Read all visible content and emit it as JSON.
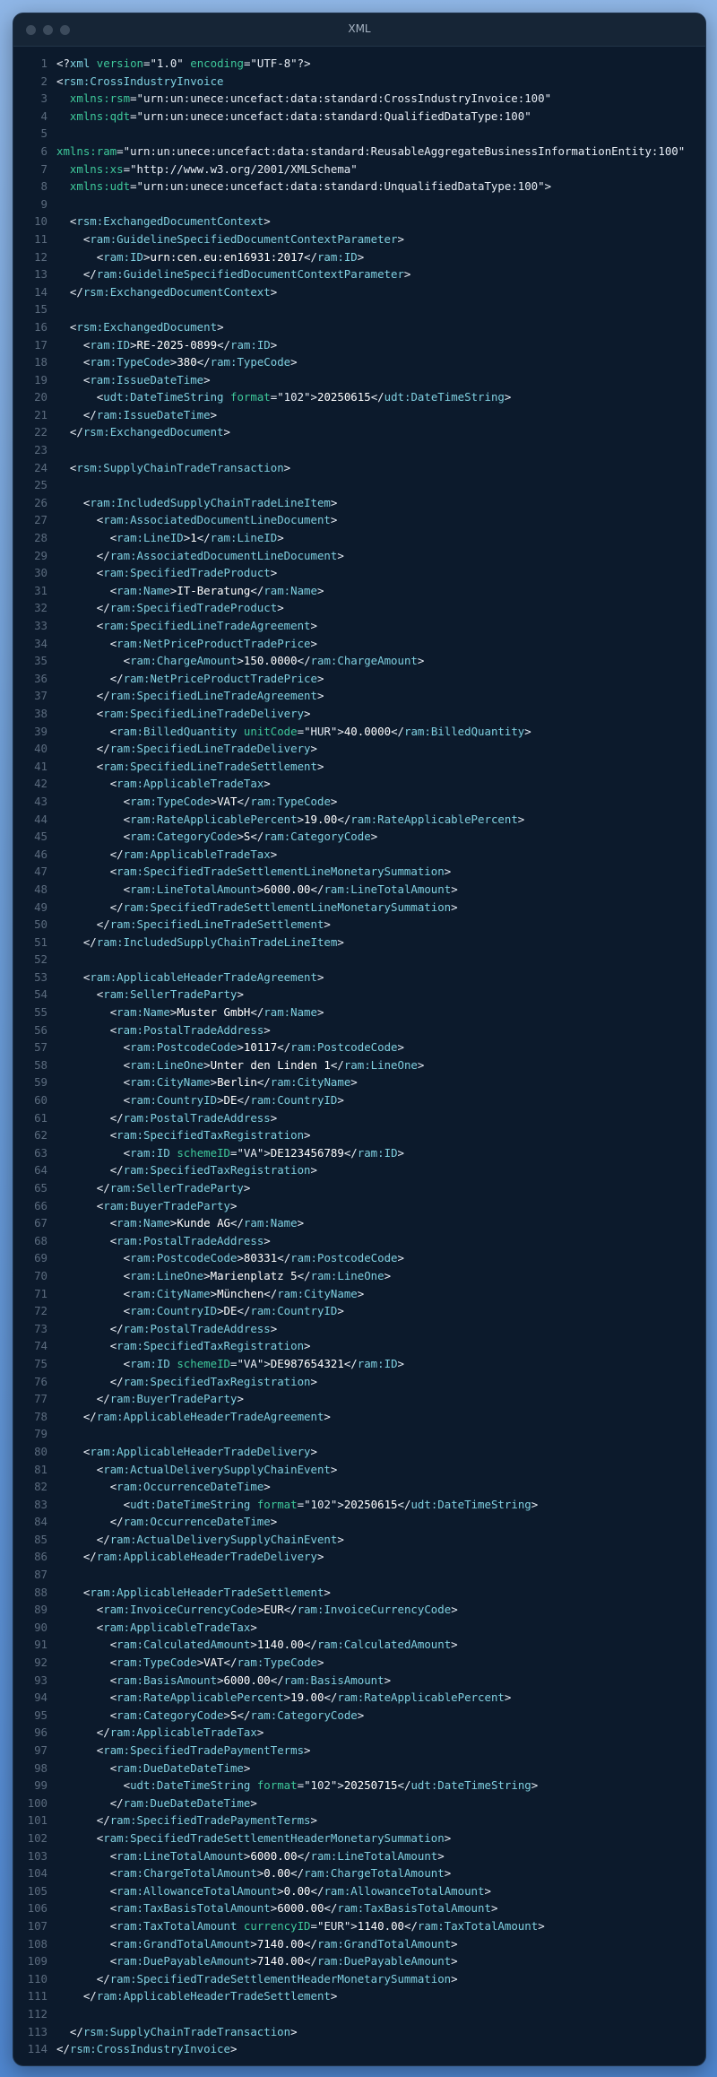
{
  "window": {
    "title": "XML"
  },
  "lines": [
    "<?xml version=\"1.0\" encoding=\"UTF-8\"?>",
    "<rsm:CrossIndustryInvoice",
    "  xmlns:rsm=\"urn:un:unece:uncefact:data:standard:CrossIndustryInvoice:100\"",
    "  xmlns:qdt=\"urn:un:unece:uncefact:data:standard:QualifiedDataType:100\"",
    "",
    "xmlns:ram=\"urn:un:unece:uncefact:data:standard:ReusableAggregateBusinessInformationEntity:100\"",
    "  xmlns:xs=\"http://www.w3.org/2001/XMLSchema\"",
    "  xmlns:udt=\"urn:un:unece:uncefact:data:standard:UnqualifiedDataType:100\">",
    "",
    "  <rsm:ExchangedDocumentContext>",
    "    <ram:GuidelineSpecifiedDocumentContextParameter>",
    "      <ram:ID>urn:cen.eu:en16931:2017</ram:ID>",
    "    </ram:GuidelineSpecifiedDocumentContextParameter>",
    "  </rsm:ExchangedDocumentContext>",
    "",
    "  <rsm:ExchangedDocument>",
    "    <ram:ID>RE-2025-0899</ram:ID>",
    "    <ram:TypeCode>380</ram:TypeCode>",
    "    <ram:IssueDateTime>",
    "      <udt:DateTimeString format=\"102\">20250615</udt:DateTimeString>",
    "    </ram:IssueDateTime>",
    "  </rsm:ExchangedDocument>",
    "",
    "  <rsm:SupplyChainTradeTransaction>",
    "",
    "    <ram:IncludedSupplyChainTradeLineItem>",
    "      <ram:AssociatedDocumentLineDocument>",
    "        <ram:LineID>1</ram:LineID>",
    "      </ram:AssociatedDocumentLineDocument>",
    "      <ram:SpecifiedTradeProduct>",
    "        <ram:Name>IT-Beratung</ram:Name>",
    "      </ram:SpecifiedTradeProduct>",
    "      <ram:SpecifiedLineTradeAgreement>",
    "        <ram:NetPriceProductTradePrice>",
    "          <ram:ChargeAmount>150.0000</ram:ChargeAmount>",
    "        </ram:NetPriceProductTradePrice>",
    "      </ram:SpecifiedLineTradeAgreement>",
    "      <ram:SpecifiedLineTradeDelivery>",
    "        <ram:BilledQuantity unitCode=\"HUR\">40.0000</ram:BilledQuantity>",
    "      </ram:SpecifiedLineTradeDelivery>",
    "      <ram:SpecifiedLineTradeSettlement>",
    "        <ram:ApplicableTradeTax>",
    "          <ram:TypeCode>VAT</ram:TypeCode>",
    "          <ram:RateApplicablePercent>19.00</ram:RateApplicablePercent>",
    "          <ram:CategoryCode>S</ram:CategoryCode>",
    "        </ram:ApplicableTradeTax>",
    "        <ram:SpecifiedTradeSettlementLineMonetarySummation>",
    "          <ram:LineTotalAmount>6000.00</ram:LineTotalAmount>",
    "        </ram:SpecifiedTradeSettlementLineMonetarySummation>",
    "      </ram:SpecifiedLineTradeSettlement>",
    "    </ram:IncludedSupplyChainTradeLineItem>",
    "",
    "    <ram:ApplicableHeaderTradeAgreement>",
    "      <ram:SellerTradeParty>",
    "        <ram:Name>Muster GmbH</ram:Name>",
    "        <ram:PostalTradeAddress>",
    "          <ram:PostcodeCode>10117</ram:PostcodeCode>",
    "          <ram:LineOne>Unter den Linden 1</ram:LineOne>",
    "          <ram:CityName>Berlin</ram:CityName>",
    "          <ram:CountryID>DE</ram:CountryID>",
    "        </ram:PostalTradeAddress>",
    "        <ram:SpecifiedTaxRegistration>",
    "          <ram:ID schemeID=\"VA\">DE123456789</ram:ID>",
    "        </ram:SpecifiedTaxRegistration>",
    "      </ram:SellerTradeParty>",
    "      <ram:BuyerTradeParty>",
    "        <ram:Name>Kunde AG</ram:Name>",
    "        <ram:PostalTradeAddress>",
    "          <ram:PostcodeCode>80331</ram:PostcodeCode>",
    "          <ram:LineOne>Marienplatz 5</ram:LineOne>",
    "          <ram:CityName>München</ram:CityName>",
    "          <ram:CountryID>DE</ram:CountryID>",
    "        </ram:PostalTradeAddress>",
    "        <ram:SpecifiedTaxRegistration>",
    "          <ram:ID schemeID=\"VA\">DE987654321</ram:ID>",
    "        </ram:SpecifiedTaxRegistration>",
    "      </ram:BuyerTradeParty>",
    "    </ram:ApplicableHeaderTradeAgreement>",
    "",
    "    <ram:ApplicableHeaderTradeDelivery>",
    "      <ram:ActualDeliverySupplyChainEvent>",
    "        <ram:OccurrenceDateTime>",
    "          <udt:DateTimeString format=\"102\">20250615</udt:DateTimeString>",
    "        </ram:OccurrenceDateTime>",
    "      </ram:ActualDeliverySupplyChainEvent>",
    "    </ram:ApplicableHeaderTradeDelivery>",
    "",
    "    <ram:ApplicableHeaderTradeSettlement>",
    "      <ram:InvoiceCurrencyCode>EUR</ram:InvoiceCurrencyCode>",
    "      <ram:ApplicableTradeTax>",
    "        <ram:CalculatedAmount>1140.00</ram:CalculatedAmount>",
    "        <ram:TypeCode>VAT</ram:TypeCode>",
    "        <ram:BasisAmount>6000.00</ram:BasisAmount>",
    "        <ram:RateApplicablePercent>19.00</ram:RateApplicablePercent>",
    "        <ram:CategoryCode>S</ram:CategoryCode>",
    "      </ram:ApplicableTradeTax>",
    "      <ram:SpecifiedTradePaymentTerms>",
    "        <ram:DueDateDateTime>",
    "          <udt:DateTimeString format=\"102\">20250715</udt:DateTimeString>",
    "        </ram:DueDateDateTime>",
    "      </ram:SpecifiedTradePaymentTerms>",
    "      <ram:SpecifiedTradeSettlementHeaderMonetarySummation>",
    "        <ram:LineTotalAmount>6000.00</ram:LineTotalAmount>",
    "        <ram:ChargeTotalAmount>0.00</ram:ChargeTotalAmount>",
    "        <ram:AllowanceTotalAmount>0.00</ram:AllowanceTotalAmount>",
    "        <ram:TaxBasisTotalAmount>6000.00</ram:TaxBasisTotalAmount>",
    "        <ram:TaxTotalAmount currencyID=\"EUR\">1140.00</ram:TaxTotalAmount>",
    "        <ram:GrandTotalAmount>7140.00</ram:GrandTotalAmount>",
    "        <ram:DuePayableAmount>7140.00</ram:DuePayableAmount>",
    "      </ram:SpecifiedTradeSettlementHeaderMonetarySummation>",
    "    </ram:ApplicableHeaderTradeSettlement>",
    "",
    "  </rsm:SupplyChainTradeTransaction>",
    "</rsm:CrossIndustryInvoice>"
  ]
}
